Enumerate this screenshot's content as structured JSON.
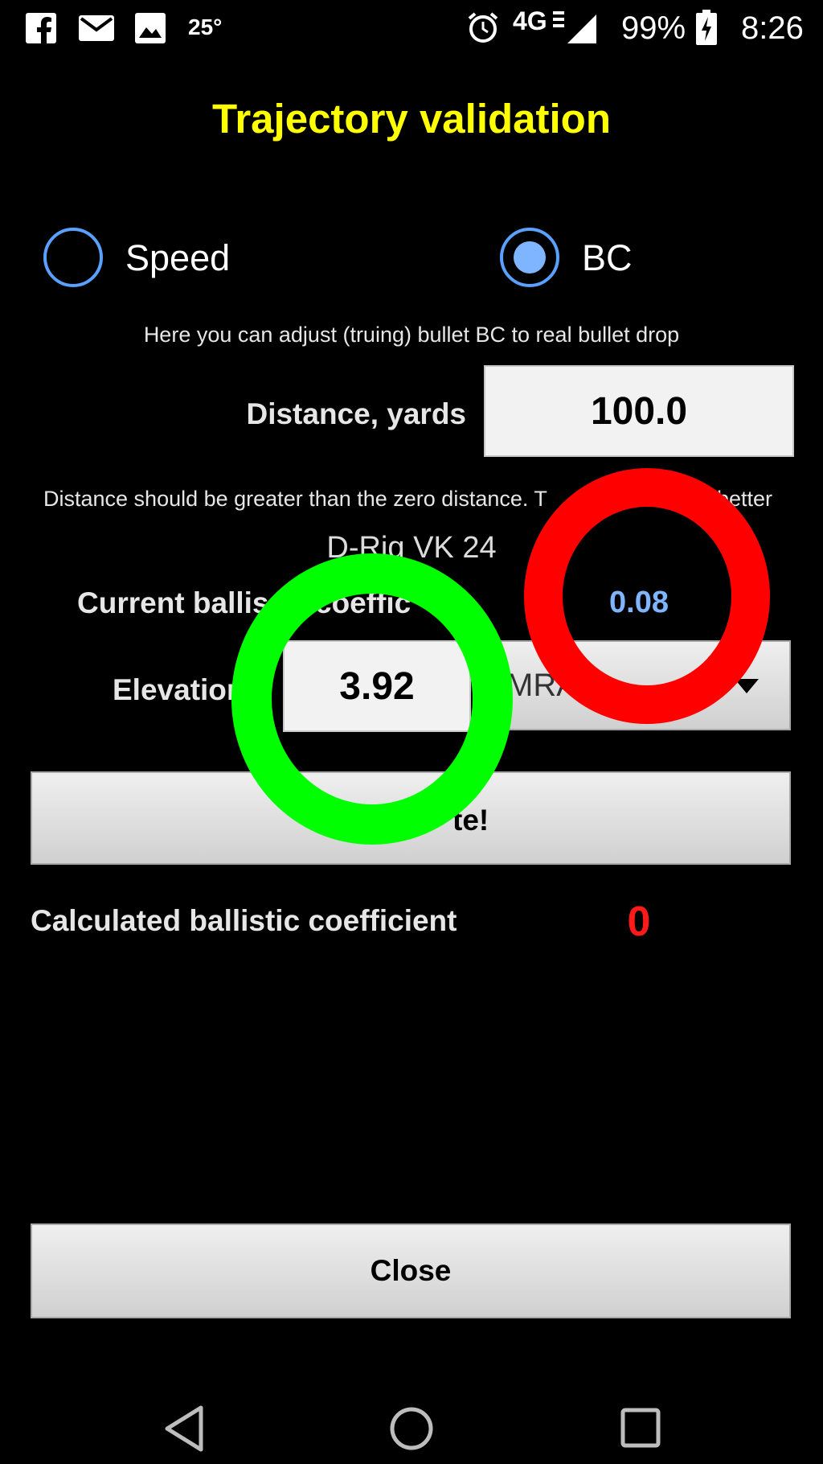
{
  "status_bar": {
    "notification_icons": [
      "facebook-icon",
      "mail-icon",
      "image-icon"
    ],
    "temperature": "25°",
    "status_icons": [
      "alarm-icon",
      "lte-icon",
      "signal-icon"
    ],
    "network": "4G",
    "battery": "99%",
    "time": "8:26"
  },
  "title": "Trajectory validation",
  "mode": {
    "speed_label": "Speed",
    "bc_label": "BC",
    "selected": "BC"
  },
  "bc_hint": "Here you can adjust (truing) bullet BC to real bullet drop",
  "distance": {
    "label": "Distance, yards",
    "value": "100.0"
  },
  "distance_hint_left": "Distance should be greater than the zero distance. T",
  "distance_hint_right": "better",
  "rifle_name": "D-Rig VK 24",
  "current_bc": {
    "label_left": "Current ballis",
    "label_right": "coeffic",
    "value": "0.08"
  },
  "elevation": {
    "label": "Elevation",
    "value": "3.92",
    "unit_visible": "MRA"
  },
  "calculate_button_visible": "te!",
  "calculated_bc": {
    "label": "Calculated ballistic coefficient",
    "value": "0"
  },
  "close_button": "Close",
  "annotations": [
    {
      "type": "circle",
      "color": "#00ff00"
    },
    {
      "type": "circle",
      "color": "#ff0000"
    }
  ],
  "colors": {
    "title": "#ffff00",
    "accent": "#5aa0ff",
    "bc_value": "#7fb4ff",
    "result_value": "#ff1a1a"
  },
  "nav_bar": {
    "icons": [
      "back-icon",
      "home-icon",
      "recents-icon"
    ]
  }
}
